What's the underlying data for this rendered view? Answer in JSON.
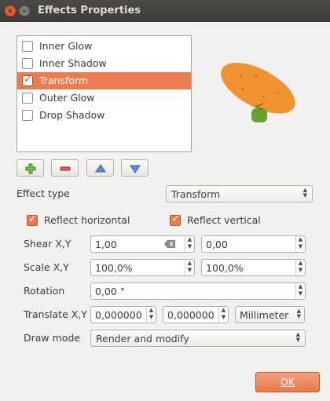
{
  "window": {
    "title": "Effects Properties"
  },
  "effects_list": [
    {
      "label": "Inner Glow",
      "checked": false,
      "selected": false
    },
    {
      "label": "Inner Shadow",
      "checked": false,
      "selected": false
    },
    {
      "label": "Transform",
      "checked": true,
      "selected": true
    },
    {
      "label": "Outer Glow",
      "checked": false,
      "selected": false
    },
    {
      "label": "Drop Shadow",
      "checked": false,
      "selected": false
    }
  ],
  "icons": {
    "add": "plus-icon",
    "remove": "minus-icon",
    "move_up": "arrow-up-icon",
    "move_down": "arrow-down-icon",
    "clear": "clear-text-icon"
  },
  "form": {
    "effect_type_label": "Effect type",
    "effect_type_value": "Transform",
    "reflect_horizontal_label": "Reflect horizontal",
    "reflect_horizontal_checked": true,
    "reflect_vertical_label": "Reflect vertical",
    "reflect_vertical_checked": true,
    "shear_label": "Shear X,Y",
    "shear_x": "1,00",
    "shear_y": "0,00",
    "scale_label": "Scale X,Y",
    "scale_x": "100,0%",
    "scale_y": "100,0%",
    "rotation_label": "Rotation",
    "rotation_value": "0,00 °",
    "translate_label": "Translate X,Y",
    "translate_x": "0,000000",
    "translate_y": "0,000000",
    "translate_unit": "Millimeter",
    "draw_mode_label": "Draw mode",
    "draw_mode_value": "Render and modify"
  },
  "buttons": {
    "ok_label": "OK"
  },
  "colors": {
    "accent": "#ea7c4f",
    "titlebar": "#3c3b37",
    "preview_fill": "#f0922f",
    "preview_marker": "#6aa12e"
  }
}
